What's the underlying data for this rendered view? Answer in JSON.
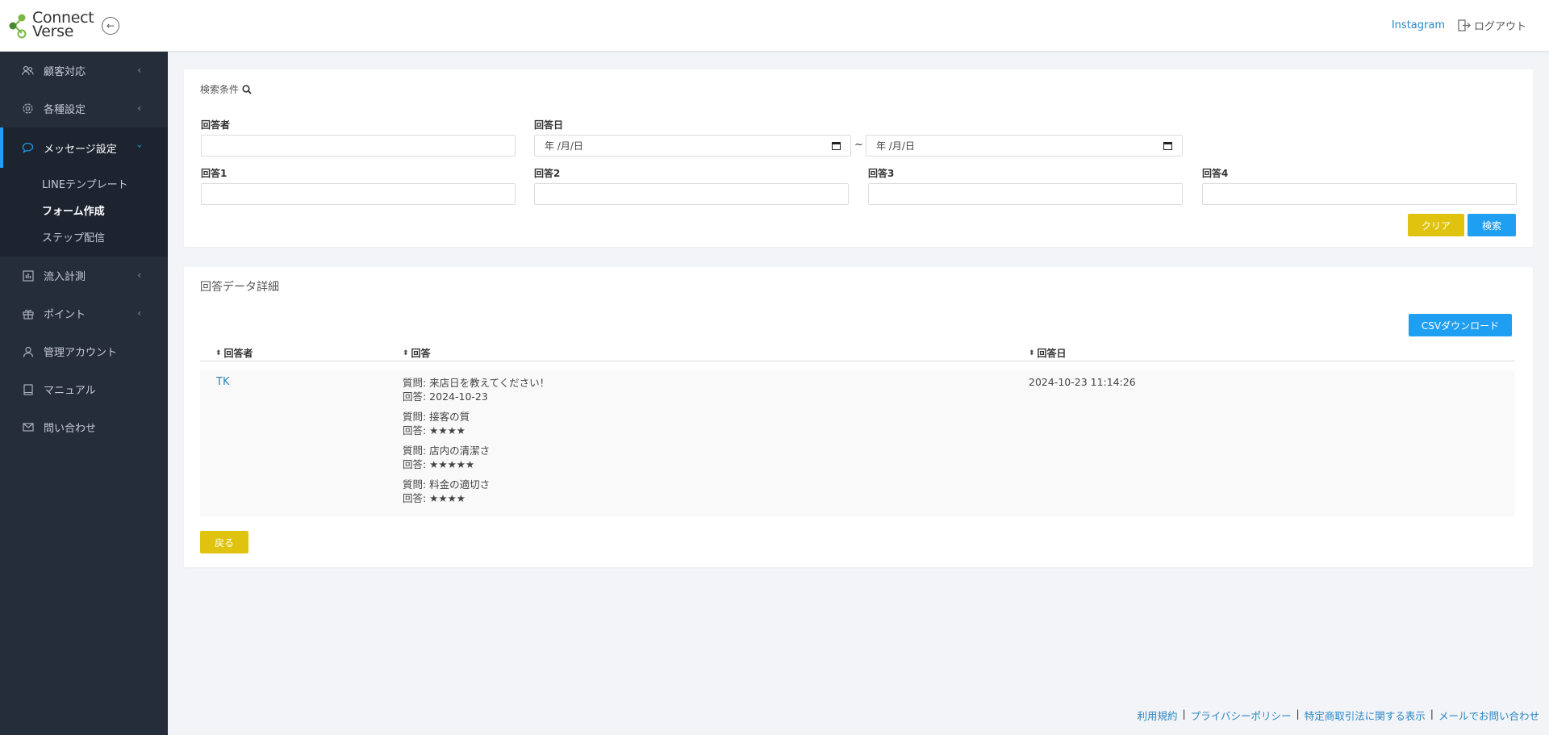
{
  "header": {
    "logo_line1": "Connect",
    "logo_line2": "Verse",
    "instagram_label": "Instagram",
    "logout_label": "ログアウト"
  },
  "sidebar": {
    "items": [
      {
        "label": "顧客対応",
        "icon": "users-icon"
      },
      {
        "label": "各種設定",
        "icon": "gear-icon"
      },
      {
        "label": "メッセージ設定",
        "icon": "chat-icon"
      },
      {
        "label": "流入計測",
        "icon": "bar-chart-icon"
      },
      {
        "label": "ポイント",
        "icon": "gift-icon"
      },
      {
        "label": "管理アカウント",
        "icon": "person-icon"
      },
      {
        "label": "マニュアル",
        "icon": "book-icon"
      },
      {
        "label": "問い合わせ",
        "icon": "mail-icon"
      }
    ],
    "subitems": [
      "LINEテンプレート",
      "フォーム作成",
      "ステップ配信"
    ]
  },
  "search": {
    "title": "検索条件",
    "respondent_label": "回答者",
    "date_label": "回答日",
    "date_from": "年 /月/日",
    "date_to": "年 /月/日",
    "tilde": "~",
    "answer1_label": "回答1",
    "answer2_label": "回答2",
    "answer3_label": "回答3",
    "answer4_label": "回答4",
    "clear_label": "クリア",
    "search_label": "検索"
  },
  "detail": {
    "title": "回答データ詳細",
    "csv_label": "CSVダウンロード",
    "columns": [
      "回答者",
      "回答",
      "回答日"
    ],
    "row": {
      "user": "TK",
      "qa": [
        {
          "q": "質問: 来店日を教えてください！",
          "a": "回答: 2024-10-23"
        },
        {
          "q": "質問: 接客の質",
          "a": "回答: ★★★★"
        },
        {
          "q": "質問: 店内の清潔さ",
          "a": "回答: ★★★★★"
        },
        {
          "q": "質問: 料金の適切さ",
          "a": "回答: ★★★★"
        }
      ],
      "date": "2024-10-23 11:14:26"
    },
    "back_label": "戻る"
  },
  "footer": {
    "links": [
      "利用規約",
      "プライバシーポリシー",
      "特定商取引法に関する表示",
      "メールでお問い合わせ"
    ],
    "sep": "|"
  },
  "colors": {
    "accent": "#1e9ff2",
    "yellow": "#e0c30f",
    "sidebar": "#262d3a"
  }
}
